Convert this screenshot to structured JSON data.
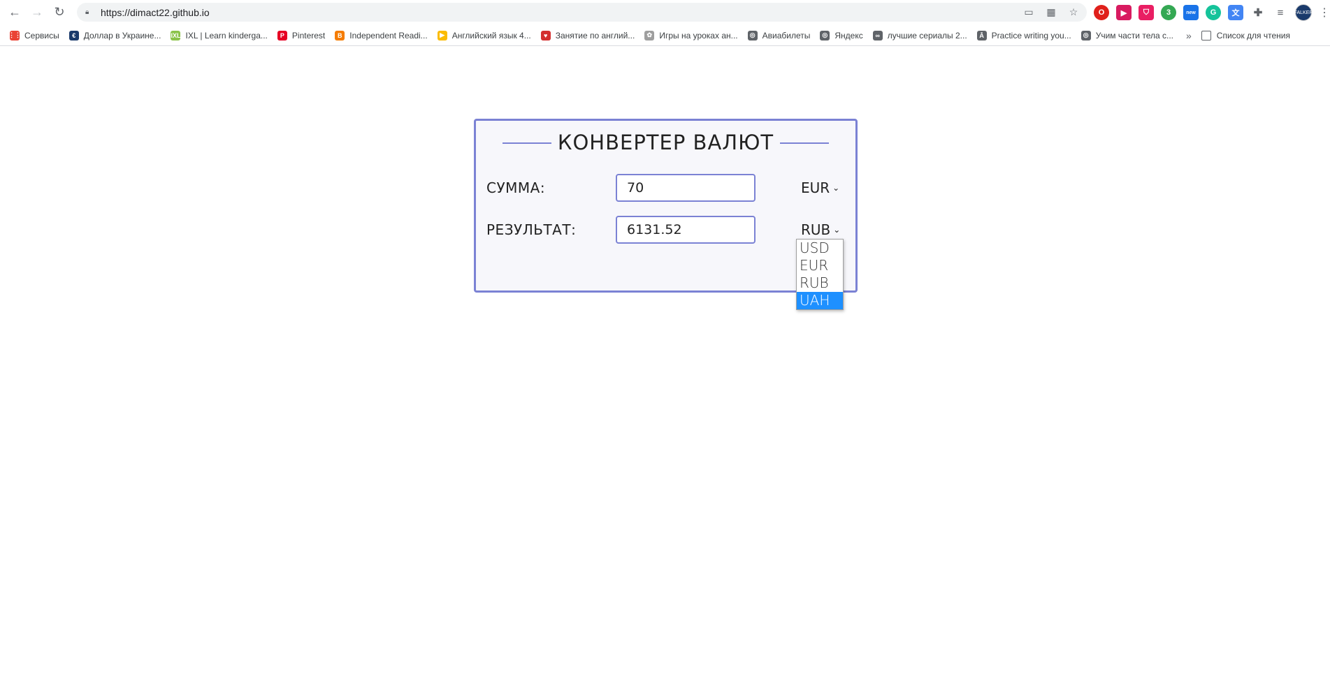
{
  "browser": {
    "url": "https://dimact22.github.io",
    "bookmarks": [
      {
        "label": "Сервисы",
        "color": "#ea4335",
        "glyph": "⋮⋮"
      },
      {
        "label": "Доллар в Украине...",
        "color": "#1a3a6b",
        "glyph": "€"
      },
      {
        "label": "IXL | Learn kinderga...",
        "color": "#8bc34a",
        "glyph": "IXL"
      },
      {
        "label": "Pinterest",
        "color": "#e60023",
        "glyph": "P"
      },
      {
        "label": "Independent Readi...",
        "color": "#f57c00",
        "glyph": "B"
      },
      {
        "label": "Английский язык 4...",
        "color": "#fbbc04",
        "glyph": "▶"
      },
      {
        "label": "Занятие по англий...",
        "color": "#d32f2f",
        "glyph": "♥"
      },
      {
        "label": "Игры на уроках ан...",
        "color": "#9e9e9e",
        "glyph": "✿"
      },
      {
        "label": "Авиабилеты",
        "color": "#5f6368",
        "glyph": "◎"
      },
      {
        "label": "Яндекс",
        "color": "#5f6368",
        "glyph": "◎"
      },
      {
        "label": "лучшие сериалы 2...",
        "color": "#5f6368",
        "glyph": "∞"
      },
      {
        "label": "Practice writing you...",
        "color": "#5f6368",
        "glyph": "Ā"
      },
      {
        "label": "Учим части тела с...",
        "color": "#5f6368",
        "glyph": "◎"
      }
    ],
    "more": "»",
    "reading_list": "Список для чтения"
  },
  "converter": {
    "title": "КОНВЕРТЕР ВАЛЮТ",
    "amount_label": "СУММА:",
    "amount_value": "70",
    "from_currency": "EUR",
    "result_label": "РЕЗУЛЬТАТ:",
    "result_value": "6131.52",
    "to_currency": "RUB",
    "dropdown_options": [
      "USD",
      "EUR",
      "RUB",
      "UAH"
    ],
    "highlighted_option": "UAH"
  },
  "colors": {
    "accent": "#7b82d4",
    "highlight": "#1e90ff"
  }
}
